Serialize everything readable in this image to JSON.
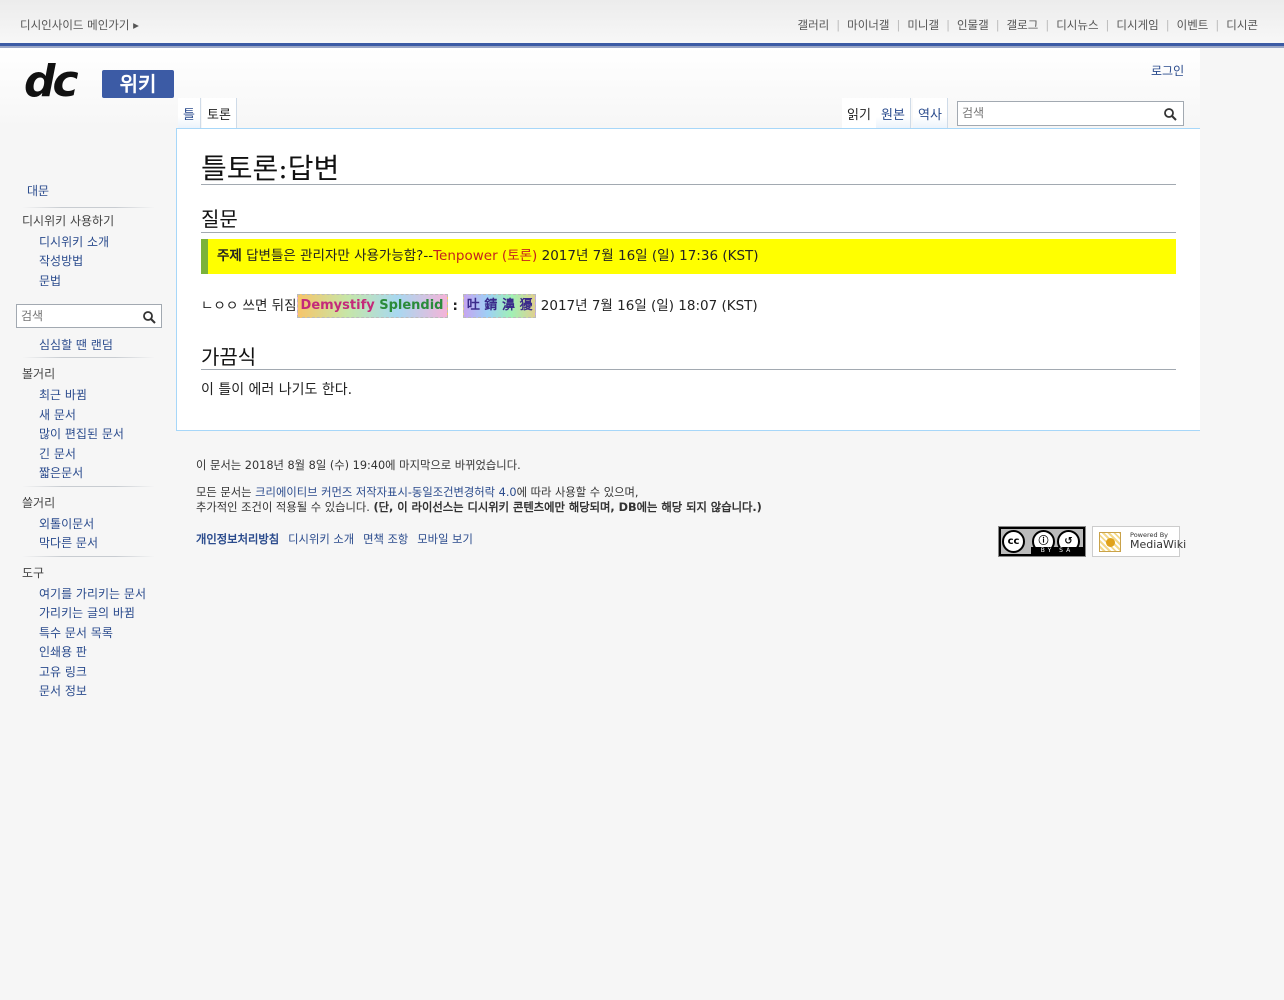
{
  "topbar": {
    "home_link": "디시인사이드 메인가기 ▸",
    "menu": [
      "갤러리",
      "마이너갤",
      "미니갤",
      "인물갤",
      "갤로그",
      "디시뉴스",
      "디시게임",
      "이벤트",
      "디시콘"
    ]
  },
  "logo": {
    "dc": "dc",
    "wiki": "위키"
  },
  "personal": {
    "login": "로그인"
  },
  "tabs": {
    "template": "틀",
    "talk": "토론",
    "read": "읽기",
    "source": "원본",
    "history": "역사"
  },
  "search": {
    "placeholder": "검색"
  },
  "page": {
    "title": "틀토론:답변",
    "section1": "질문",
    "notice": {
      "label": "주제",
      "text": " 답변틀은 관리자만 사용가능함?--",
      "user": "Tenpower",
      "talk_open": " (",
      "talk": "토론",
      "talk_close": ")",
      "time": " 2017년 7월 16일 (일) 17:36 (KST)"
    },
    "reply": {
      "text": "ㄴㅇㅇ 쓰면 뒤짐",
      "sig_part1": "Demystify",
      "sig_part2": " Splendid",
      "colon": ":",
      "sig_hanja": "吐 錆 濞 獶",
      "time": " 2017년 7월 16일 (일) 18:07 (KST)"
    },
    "section2": "가끔식",
    "section2_text": "이 틀이 에러 나기도 한다."
  },
  "sidebar": {
    "main": "대문",
    "group1_title": "디시위키 사용하기",
    "group1": [
      "디시위키 소개",
      "작성방법",
      "문법"
    ],
    "search_placeholder": "검색",
    "random": "심심할 땐 랜덤",
    "group2_title": "볼거리",
    "group2": [
      "최근 바뀜",
      "새 문서",
      "많이 편집된 문서",
      "긴 문서",
      "짧은문서"
    ],
    "group3_title": "쓸거리",
    "group3": [
      "외톨이문서",
      "막다른 문서"
    ],
    "group4_title": "도구",
    "group4": [
      "여기를 가리키는 문서",
      "가리키는 글의 바뀜",
      "특수 문서 목록",
      "인쇄용 판",
      "고유 링크",
      "문서 정보"
    ]
  },
  "footer": {
    "lastmod": "이 문서는 2018년 8월 8일 (수) 19:40에 마지막으로 바뀌었습니다.",
    "license_pre": "모든 문서는 ",
    "license_link": "크리에이티브 커먼즈 저작자표시-동일조건변경허락 4.0",
    "license_post": "에 따라 사용할 수 있으며,",
    "license_line2": "추가적인 조건이 적용될 수 있습니다. ",
    "license_bold": "(단, 이 라이선스는 디시위키 콘텐츠에만 해당되며, DB에는 해당 되지 않습니다.)",
    "links": [
      "개인정보처리방침",
      "디시위키 소개",
      "면책 조항",
      "모바일 보기"
    ],
    "cc_badge": {
      "cc": "cc",
      "by": "BY",
      "sa": "SA"
    },
    "mw_badge": {
      "powered": "Powered By",
      "name": "MediaWiki"
    }
  }
}
